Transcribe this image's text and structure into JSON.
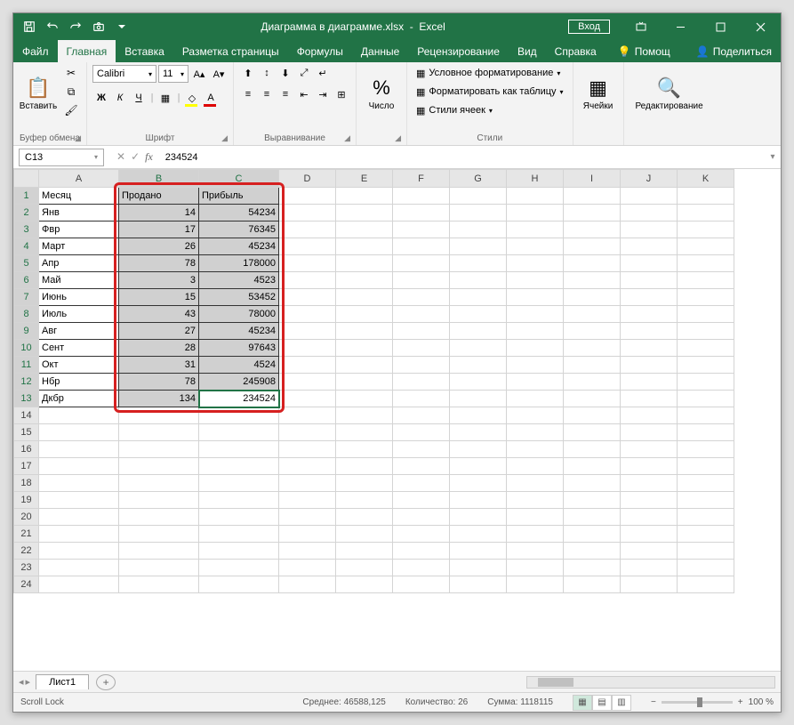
{
  "title": {
    "filename": "Диаграмма в диаграмме.xlsx",
    "app": "Excel",
    "login": "Вход"
  },
  "tabs": {
    "file": "Файл",
    "home": "Главная",
    "insert": "Вставка",
    "layout": "Разметка страницы",
    "formulas": "Формулы",
    "data": "Данные",
    "review": "Рецензирование",
    "view": "Вид",
    "help": "Справка",
    "helptext": "Помощ",
    "share": "Поделиться"
  },
  "ribbon": {
    "clipboard": {
      "paste": "Вставить",
      "label": "Буфер обмена"
    },
    "font": {
      "name": "Calibri",
      "size": "11",
      "label": "Шрифт"
    },
    "alignment": {
      "label": "Выравнивание"
    },
    "number": {
      "label": "Число"
    },
    "styles": {
      "cond": "Условное форматирование",
      "table": "Форматировать как таблицу",
      "cell": "Стили ячеек",
      "label": "Стили"
    },
    "cells": {
      "label": "Ячейки"
    },
    "editing": {
      "label": "Редактирование"
    }
  },
  "namebox": "C13",
  "formula": "234524",
  "columns": [
    "A",
    "B",
    "C",
    "D",
    "E",
    "F",
    "G",
    "H",
    "I",
    "J",
    "K"
  ],
  "rows": [
    {
      "n": 1,
      "a": "Месяц",
      "b": "Продано",
      "c": "Прибыль"
    },
    {
      "n": 2,
      "a": "Янв",
      "b": 14,
      "c": 54234
    },
    {
      "n": 3,
      "a": "Фвр",
      "b": 17,
      "c": 76345
    },
    {
      "n": 4,
      "a": "Март",
      "b": 26,
      "c": 45234
    },
    {
      "n": 5,
      "a": "Апр",
      "b": 78,
      "c": 178000
    },
    {
      "n": 6,
      "a": "Май",
      "b": 3,
      "c": 4523
    },
    {
      "n": 7,
      "a": "Июнь",
      "b": 15,
      "c": 53452
    },
    {
      "n": 8,
      "a": "Июль",
      "b": 43,
      "c": 78000
    },
    {
      "n": 9,
      "a": "Авг",
      "b": 27,
      "c": 45234
    },
    {
      "n": 10,
      "a": "Сент",
      "b": 28,
      "c": 97643
    },
    {
      "n": 11,
      "a": "Окт",
      "b": 31,
      "c": 4524
    },
    {
      "n": 12,
      "a": "Нбр",
      "b": 78,
      "c": 245908
    },
    {
      "n": 13,
      "a": "Дкбр",
      "b": 134,
      "c": 234524
    }
  ],
  "empty_rows": [
    14,
    15,
    16,
    17,
    18,
    19,
    20,
    21,
    22,
    23,
    24
  ],
  "sheet": {
    "name": "Лист1"
  },
  "status": {
    "scroll": "Scroll Lock",
    "avg_label": "Среднее:",
    "avg": "46588,125",
    "count_label": "Количество:",
    "count": "26",
    "sum_label": "Сумма:",
    "sum": "1118115",
    "zoom": "100 %"
  }
}
